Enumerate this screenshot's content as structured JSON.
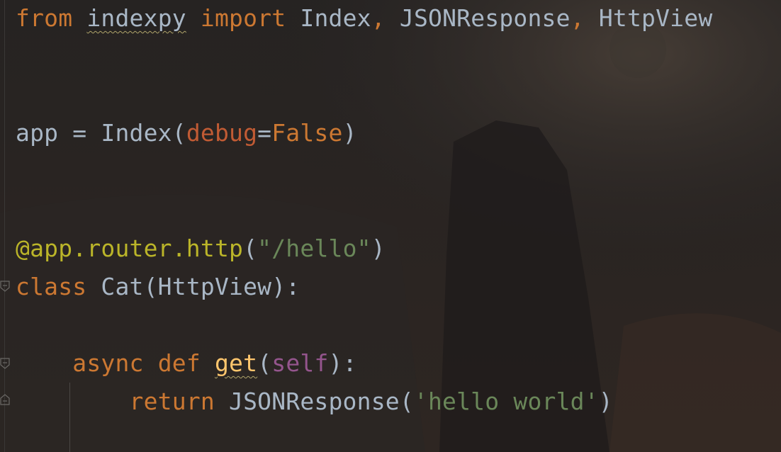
{
  "code_lines": [
    {
      "tokens": [
        "from",
        " ",
        "indexpy",
        " ",
        "import",
        " Index",
        ",",
        " JSONResponse",
        ",",
        " HttpView"
      ]
    },
    {
      "tokens": [
        "app = Index(",
        "debug",
        "=",
        "False",
        ")"
      ]
    },
    {
      "tokens": [
        "@app.router.http",
        "(",
        "\"/hello\"",
        ")"
      ]
    },
    {
      "tokens": [
        "class",
        " Cat(HttpView):"
      ]
    },
    {
      "tokens": [
        "    ",
        "async",
        " ",
        "def",
        " ",
        "get",
        "(",
        "self",
        "):"
      ]
    },
    {
      "tokens": [
        "        ",
        "return",
        " JSONResponse(",
        "'hello world'",
        ")"
      ]
    }
  ],
  "colors": {
    "background": "#242222",
    "keyword": "#cc7832",
    "identifier": "#a9b7c6",
    "parameter": "#c15b34",
    "decorator": "#bbb529",
    "string": "#6a8759",
    "self": "#94558d",
    "function_name": "#ffc66d"
  },
  "icons": [
    "fold-start-icon",
    "fold-start-icon",
    "fold-end-icon"
  ]
}
